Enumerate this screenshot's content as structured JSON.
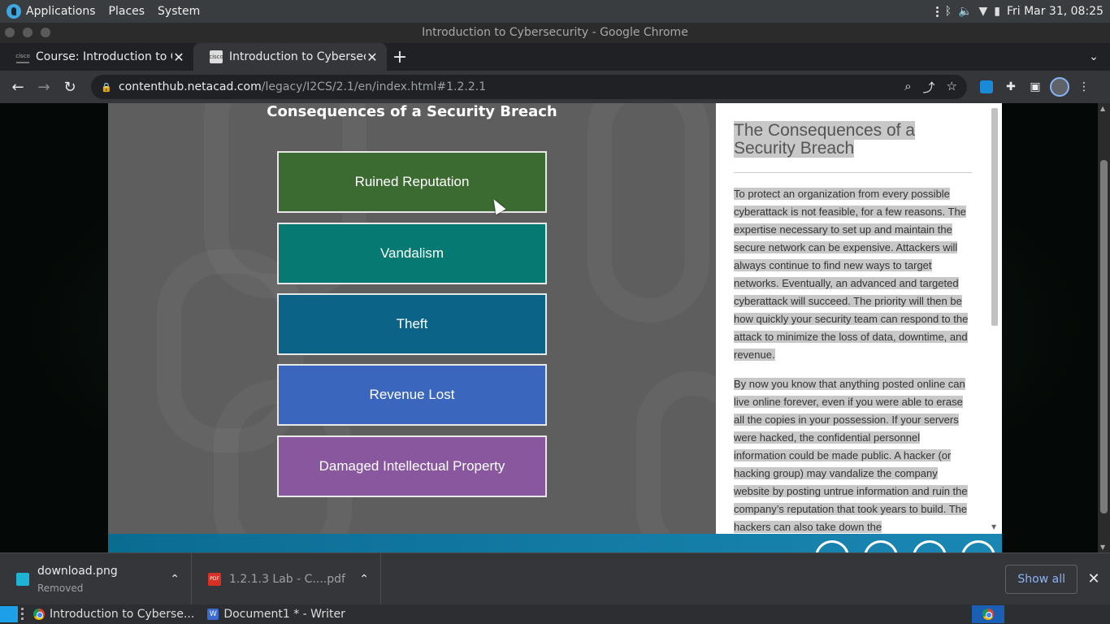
{
  "top_panel": {
    "applications": "Applications",
    "places": "Places",
    "system": "System",
    "clock": "Fri Mar 31, 08:25"
  },
  "window": {
    "title": "Introduction to Cybersecurity - Google Chrome"
  },
  "tabs": [
    {
      "title": "Course: Introduction to Cyb",
      "active": false
    },
    {
      "title": "Introduction to Cybersecurity",
      "active": true
    }
  ],
  "omnibox": {
    "domain": "contenthub.netacad.com",
    "path": "/legacy/I2CS/2.1/en/index.html#1.2.2.1"
  },
  "slide": {
    "title": "Consequences of a Security Breach",
    "buttons": [
      {
        "label": "Ruined Reputation",
        "color": "#3b6b31"
      },
      {
        "label": "Vandalism",
        "color": "#067a72"
      },
      {
        "label": "Theft",
        "color": "#0c6388"
      },
      {
        "label": "Revenue Lost",
        "color": "#3a67bd"
      },
      {
        "label": "Damaged Intellectual Property",
        "color": "#88579e"
      }
    ]
  },
  "text_panel": {
    "heading": "The Consequences of a Security Breach",
    "paragraphs": [
      "To protect an organization from every possible cyberattack is not feasible, for a few reasons. The expertise necessary to set up and maintain the secure network can be expensive. Attackers will always continue to find new ways to target networks. Eventually, an advanced and targeted cyberattack will succeed. The priority will then be how quickly your security team can respond to the attack to minimize the loss of data, downtime, and revenue.",
      "By now you know that anything posted online can live online forever, even if you were able to erase all the copies in your possession. If your servers were hacked, the confidential personnel information could be made public. A hacker (or hacking group) may vandalize the company website by posting untrue information and ruin the company’s reputation that took years to build. The hackers can also take down the"
    ]
  },
  "downloads": [
    {
      "name": "download.png",
      "status": "Removed",
      "icon": "image-icon"
    },
    {
      "name": "1.2.1.3 Lab - C....pdf",
      "status": "",
      "icon": "pdf-icon"
    }
  ],
  "downloads_bar": {
    "show_all": "Show all"
  },
  "taskbar": {
    "items": [
      {
        "label": "Introduction to Cyberse...",
        "icon": "chrome-icon"
      },
      {
        "label": "Document1 * - Writer",
        "icon": "writer-icon"
      }
    ]
  },
  "accent_colors": {
    "nav_bar": "#0b6c92",
    "selection": "#c8c8c8",
    "link": "#8ab4f8"
  }
}
